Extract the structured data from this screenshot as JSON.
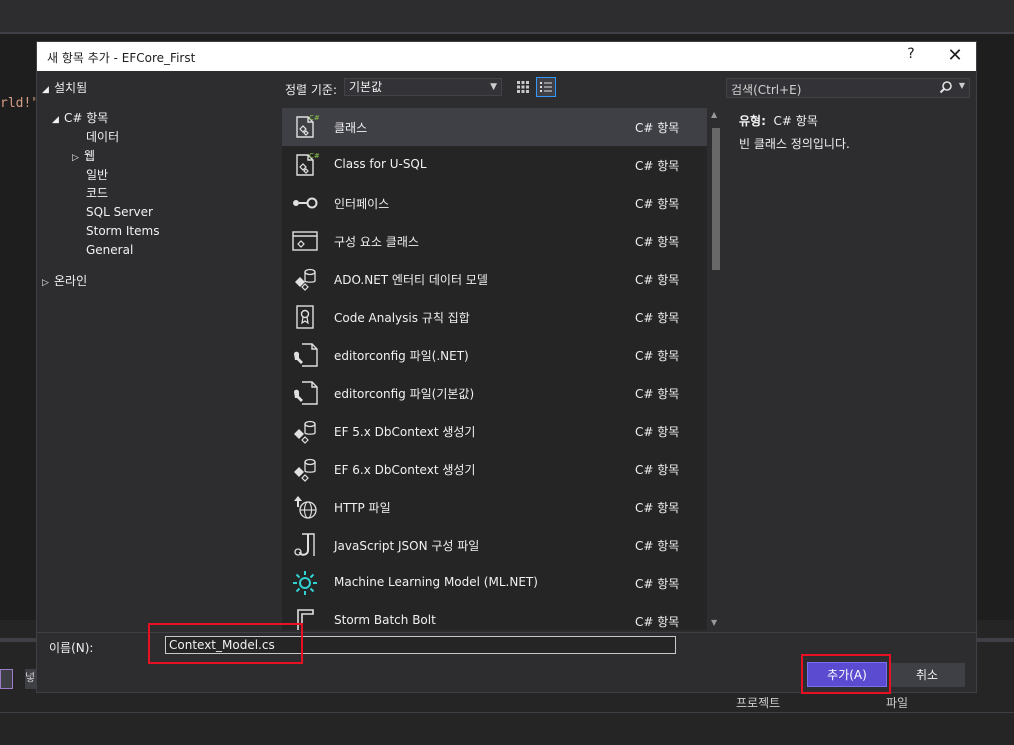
{
  "background": {
    "code_fragment": "rld!\"",
    "columns": [
      "프로젝트",
      "파일"
    ],
    "tool_glyph": "넣"
  },
  "dialog": {
    "title": "새 항목 추가 - EFCore_First",
    "help": "?",
    "close": "✕"
  },
  "tree": {
    "installed": "설치됨",
    "csharp": "C# 항목",
    "data": "데이터",
    "web": "웹",
    "general_ko": "일반",
    "code": "코드",
    "sql": "SQL Server",
    "storm": "Storm Items",
    "general": "General",
    "online": "온라인"
  },
  "sort": {
    "label": "정렬 기준:",
    "value": "기본값"
  },
  "items": [
    {
      "name": "클래스",
      "category": "C# 항목",
      "icon": "class-icon"
    },
    {
      "name": "Class for U-SQL",
      "category": "C# 항목",
      "icon": "class-icon"
    },
    {
      "name": "인터페이스",
      "category": "C# 항목",
      "icon": "interface-icon"
    },
    {
      "name": "구성 요소 클래스",
      "category": "C# 항목",
      "icon": "component-icon"
    },
    {
      "name": "ADO.NET 엔터티 데이터 모델",
      "category": "C# 항목",
      "icon": "entity-model-icon"
    },
    {
      "name": "Code Analysis 규칙 집합",
      "category": "C# 항목",
      "icon": "ruleset-icon"
    },
    {
      "name": "editorconfig 파일(.NET)",
      "category": "C# 항목",
      "icon": "editorconfig-icon"
    },
    {
      "name": "editorconfig 파일(기본값)",
      "category": "C# 항목",
      "icon": "editorconfig-icon"
    },
    {
      "name": "EF 5.x DbContext 생성기",
      "category": "C# 항목",
      "icon": "dbcontext-icon"
    },
    {
      "name": "EF 6.x DbContext 생성기",
      "category": "C# 항목",
      "icon": "dbcontext-icon"
    },
    {
      "name": "HTTP 파일",
      "category": "C# 항목",
      "icon": "http-icon"
    },
    {
      "name": "JavaScript JSON 구성 파일",
      "category": "C# 항목",
      "icon": "json-icon"
    },
    {
      "name": "Machine Learning Model (ML.NET)",
      "category": "C# 항목",
      "icon": "ml-icon"
    },
    {
      "name": "Storm Batch Bolt",
      "category": "C# 항목",
      "icon": "storm-icon"
    }
  ],
  "search": {
    "placeholder": "검색(Ctrl+E)"
  },
  "info": {
    "type_label": "유형:",
    "type_value": "C# 항목",
    "description": "빈 클래스 정의입니다."
  },
  "name_field": {
    "label": "이름(N):",
    "value": "Context_Model.cs"
  },
  "buttons": {
    "add": "추가(A)",
    "cancel": "취소"
  },
  "colors": {
    "accent": "#5b4bd1",
    "highlight": "#e81123",
    "dialog_bg": "#2d2d30"
  }
}
